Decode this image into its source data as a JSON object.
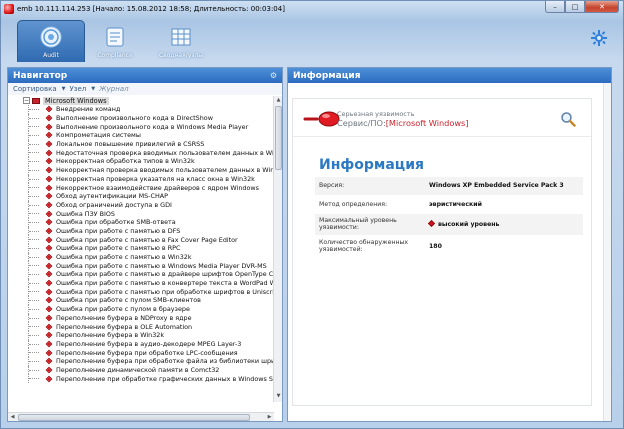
{
  "window": {
    "title": "emb 10.111.114.253 [Начало: 15.08.2012 18:58; Длительность: 00:03:04]",
    "minimize": "–",
    "maximize": "□",
    "close": "✕"
  },
  "ribbon": {
    "tabs": [
      {
        "label": "Audit",
        "icon": "audit-icon",
        "active": true
      },
      {
        "label": "Compliance",
        "icon": "compliance-icon",
        "active": false
      },
      {
        "label": "Сводная/узлы",
        "icon": "summary-grid-icon",
        "active": false
      }
    ]
  },
  "navigator": {
    "title": "Навигатор",
    "toolbar": {
      "sort": "Сортировка",
      "node": "Узел",
      "journal": "Журнал"
    },
    "root": "Microsoft Windows",
    "items": [
      "Внедрение команд",
      "Выполнение произвольного кода в DirectShow",
      "Выполнение произвольного кода в Windows Media Player",
      "Компрометация системы",
      "Локальное повышение привилегий в CSRSS",
      "Недостаточная проверка вводимых пользователем данных в Win32k",
      "Некорректная обработка типов в Win32k",
      "Некорректная проверка вводимых пользователем данных в Win32k",
      "Некорректная проверка указателя на класс окна в Win32k",
      "Некорректное взаимодействие драйверов с ядром Windows",
      "Обход аутентификации MS-CHAP",
      "Обход ограничений доступа в GDI",
      "Ошибка ПЗУ BIOS",
      "Ошибка при обработке SMB-ответа",
      "Ошибка при работе с памятью в DFS",
      "Ошибка при работе с памятью в Fax Cover Page Editor",
      "Ошибка при работе с памятью в RPC",
      "Ошибка при работе с памятью в Win32k",
      "Ошибка при работе с памятью в Windows Media Player DVR-MS",
      "Ошибка при работе с памятью в драйвере шрифтов OpenType CFF",
      "Ошибка при работе с памятью в конвертере текста в WordPad Word 97",
      "Ошибка при работе с памятью при обработке шрифтов в Uniscribe",
      "Ошибка при работе с пулом SMB-клиентов",
      "Ошибка при работе с пулом в браузере",
      "Переполнение буфера в NDProxy в ядре",
      "Переполнение буфера в OLE Automation",
      "Переполнение буфера в Win32k",
      "Переполнение буфера в аудио-декодере MPEG Layer-3",
      "Переполнение буфера при обработке LPC-сообщения",
      "Переполнение буфера при обработке файла из библиотеки шрифтов",
      "Переполнение динамической памяти в Comct32",
      "Переполнение при обработке графических данных в Windows Shell"
    ]
  },
  "info_panel": {
    "title": "Информация",
    "severity_caption": "Серьезная уязвимость",
    "service_caption": "Сервис/ПО:",
    "service_value": "[Microsoft Windows]",
    "section_title": "Информация",
    "rows": [
      {
        "key": "Версия:",
        "value": "Windows XP Embedded Service Pack 3"
      },
      {
        "key": "Метод определения:",
        "value": "эвристический"
      },
      {
        "key": "Максимальный уровень уязвимости:",
        "value": "высокий уровень"
      },
      {
        "key": "Количество обнаруженных уязвимостей:",
        "value": "180"
      }
    ]
  },
  "colors": {
    "accent": "#2c79c3",
    "severity": "#d4141c",
    "header_blue": "#2c6bbf"
  }
}
